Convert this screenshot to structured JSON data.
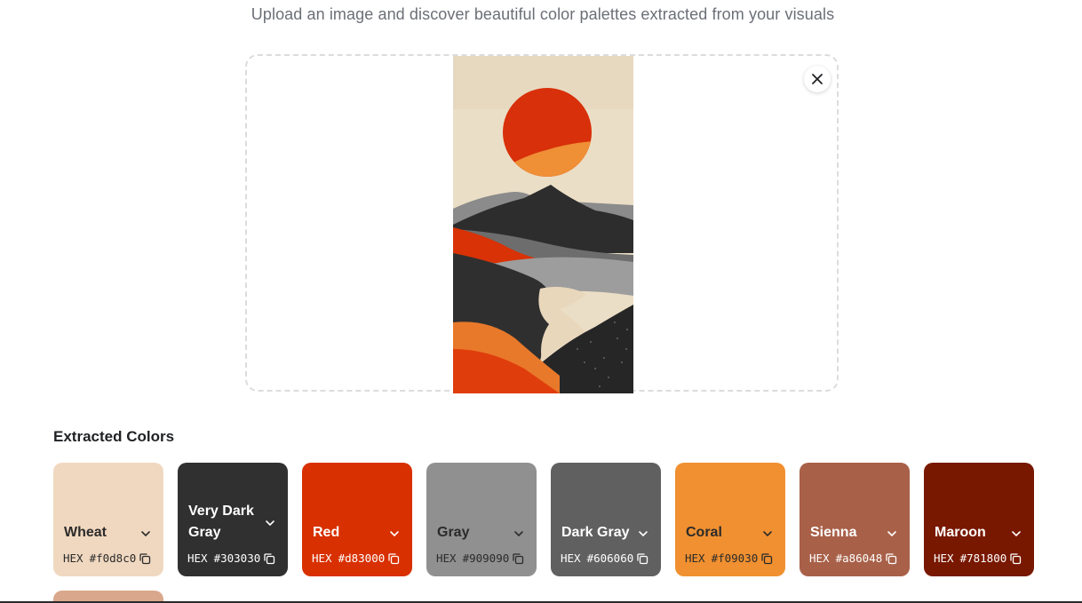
{
  "header": {
    "subtitle": "Upload an image and discover beautiful color palettes extracted from your visuals"
  },
  "upload": {
    "close_icon": "close-icon"
  },
  "palette": {
    "title": "Extracted Colors",
    "hex_prefix": "HEX",
    "colors": [
      {
        "name": "Wheat",
        "hex": "#f0d8c0",
        "text": "#2b2b2b"
      },
      {
        "name": "Very Dark Gray",
        "hex": "#303030",
        "text": "#ffffff"
      },
      {
        "name": "Red",
        "hex": "#d83000",
        "text": "#ffffff"
      },
      {
        "name": "Gray",
        "hex": "#909090",
        "text": "#2b2b2b"
      },
      {
        "name": "Dark Gray",
        "hex": "#606060",
        "text": "#ffffff"
      },
      {
        "name": "Coral",
        "hex": "#f09030",
        "text": "#2b2b2b"
      },
      {
        "name": "Sienna",
        "hex": "#a86048",
        "text": "#ffffff"
      },
      {
        "name": "Maroon",
        "hex": "#781800",
        "text": "#ffffff"
      }
    ]
  }
}
